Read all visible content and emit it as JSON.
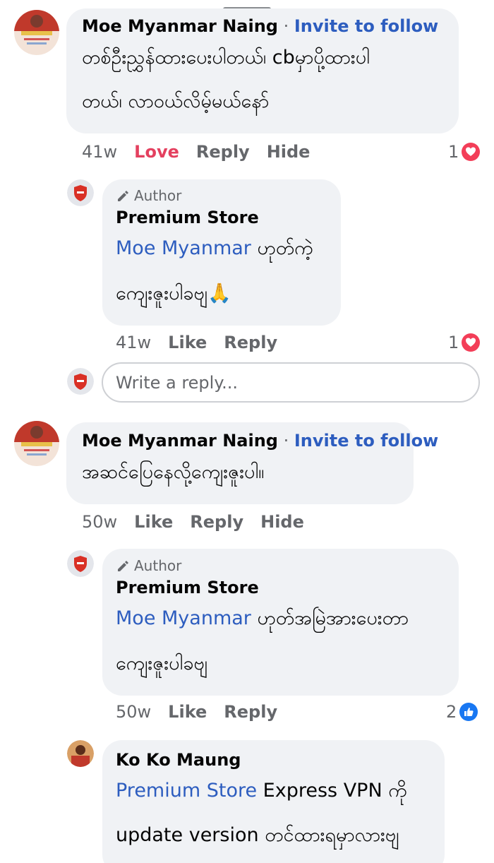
{
  "comments": [
    {
      "name": "Moe Myanmar Naing",
      "separator": " · ",
      "invite": "Invite to follow",
      "lines": [
        "တစ်ဦးညွှန်ထားပေးပါတယ်၊ cbမှာပို့ထားပါ",
        "တယ်၊ လာဝယ်လိမ့်မယ်နော်"
      ],
      "time": "41w",
      "react_label": "Love",
      "reply": "Reply",
      "hide": "Hide",
      "reaction_count": "1",
      "reaction_icon": "heart-icon"
    },
    {
      "author_badge": "Author",
      "name": "Premium Store",
      "mention": "Moe Myanmar",
      "line1_rest": " ဟုတ်ကဲ့",
      "line2": "ကျေးဇူးပါခဗျ🙏",
      "time": "41w",
      "react_label": "Like",
      "reply": "Reply",
      "reaction_count": "1",
      "reaction_icon": "heart-icon"
    },
    {
      "name": "Moe Myanmar Naing",
      "separator": " · ",
      "invite": "Invite to follow",
      "lines": [
        "အဆင်ပြေနေလို့ကျေးဇူးပါ။"
      ],
      "time": "50w",
      "react_label": "Like",
      "reply": "Reply",
      "hide": "Hide"
    },
    {
      "author_badge": "Author",
      "name": "Premium Store",
      "mention": "Moe Myanmar",
      "line1_rest": " ဟုတ်အမြဲအားပေးတာ",
      "line2": "ကျေးဇူးပါခဗျ",
      "time": "50w",
      "react_label": "Like",
      "reply": "Reply",
      "reaction_count": "2",
      "reaction_icon": "like-icon"
    },
    {
      "name": "Ko Ko Maung",
      "mention": "Premium Store",
      "line1_rest": " Express VPN ကို",
      "line2": "update version တင်ထားရမှာလားဗျ"
    }
  ],
  "reply_box": {
    "placeholder": "Write a reply..."
  },
  "colors": {
    "link": "#2d5dbf",
    "love": "#e4405f",
    "bubble": "#f0f2f5",
    "meta": "#65676b"
  }
}
